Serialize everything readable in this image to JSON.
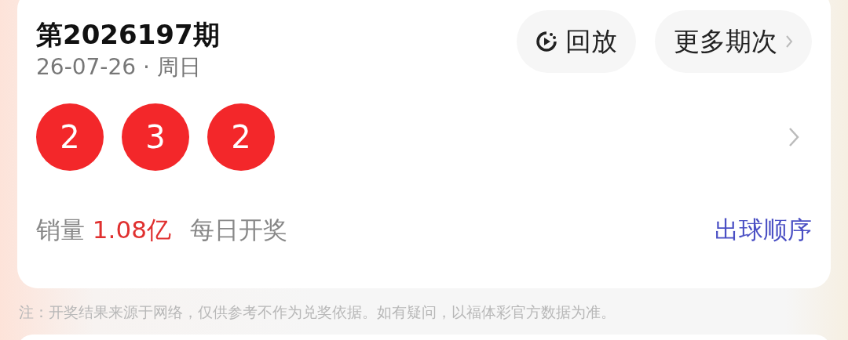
{
  "draw": {
    "title": "第2026197期",
    "date": "26-07-26 · 周日",
    "buttons": [
      {
        "kind": "replay",
        "label": "回放"
      },
      {
        "kind": "more",
        "label": "更多期次"
      }
    ],
    "balls": [
      "2",
      "3",
      "2"
    ],
    "sales_label": "销量",
    "sales_value": "1.08亿",
    "frequency": "每日开奖",
    "order_link": "出球顺序"
  },
  "note": "注：开奖结果来源于网络，仅供参考不作为兑奖依据。如有疑问，以福体彩官方数据为准。"
}
